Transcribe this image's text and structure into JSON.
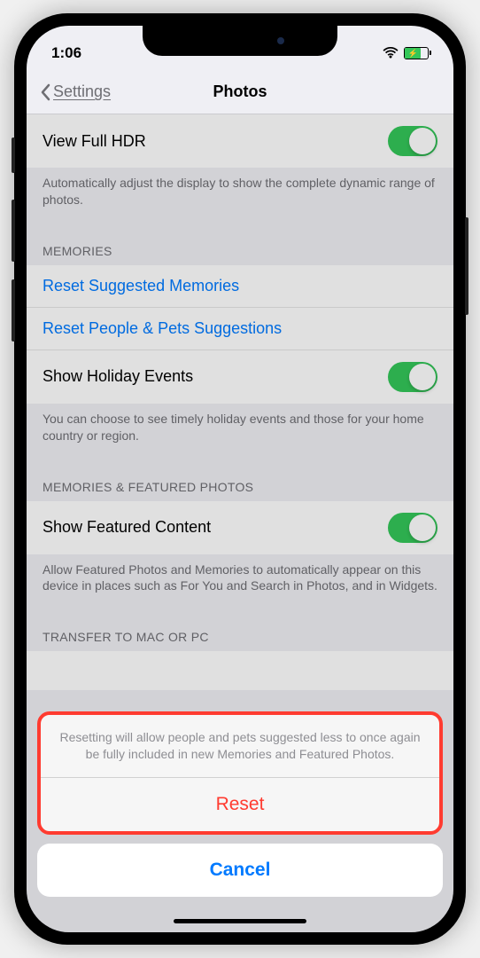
{
  "status": {
    "time": "1:06"
  },
  "nav": {
    "back_label": "Settings",
    "title": "Photos"
  },
  "hdr": {
    "label": "View Full HDR",
    "footer": "Automatically adjust the display to show the complete dynamic range of photos."
  },
  "memories": {
    "header": "MEMORIES",
    "reset_suggested": "Reset Suggested Memories",
    "reset_people": "Reset People & Pets Suggestions",
    "show_holiday": "Show Holiday Events",
    "footer": "You can choose to see timely holiday events and those for your home country or region."
  },
  "featured": {
    "header": "MEMORIES & FEATURED PHOTOS",
    "show_featured": "Show Featured Content",
    "footer": "Allow Featured Photos and Memories to automatically appear on this device in places such as For You and Search in Photos, and in Widgets."
  },
  "transfer": {
    "header": "TRANSFER TO MAC OR PC"
  },
  "action_sheet": {
    "message": "Resetting will allow people and pets suggested less to once again be fully included in new Memories and Featured Photos.",
    "reset": "Reset",
    "cancel": "Cancel"
  }
}
